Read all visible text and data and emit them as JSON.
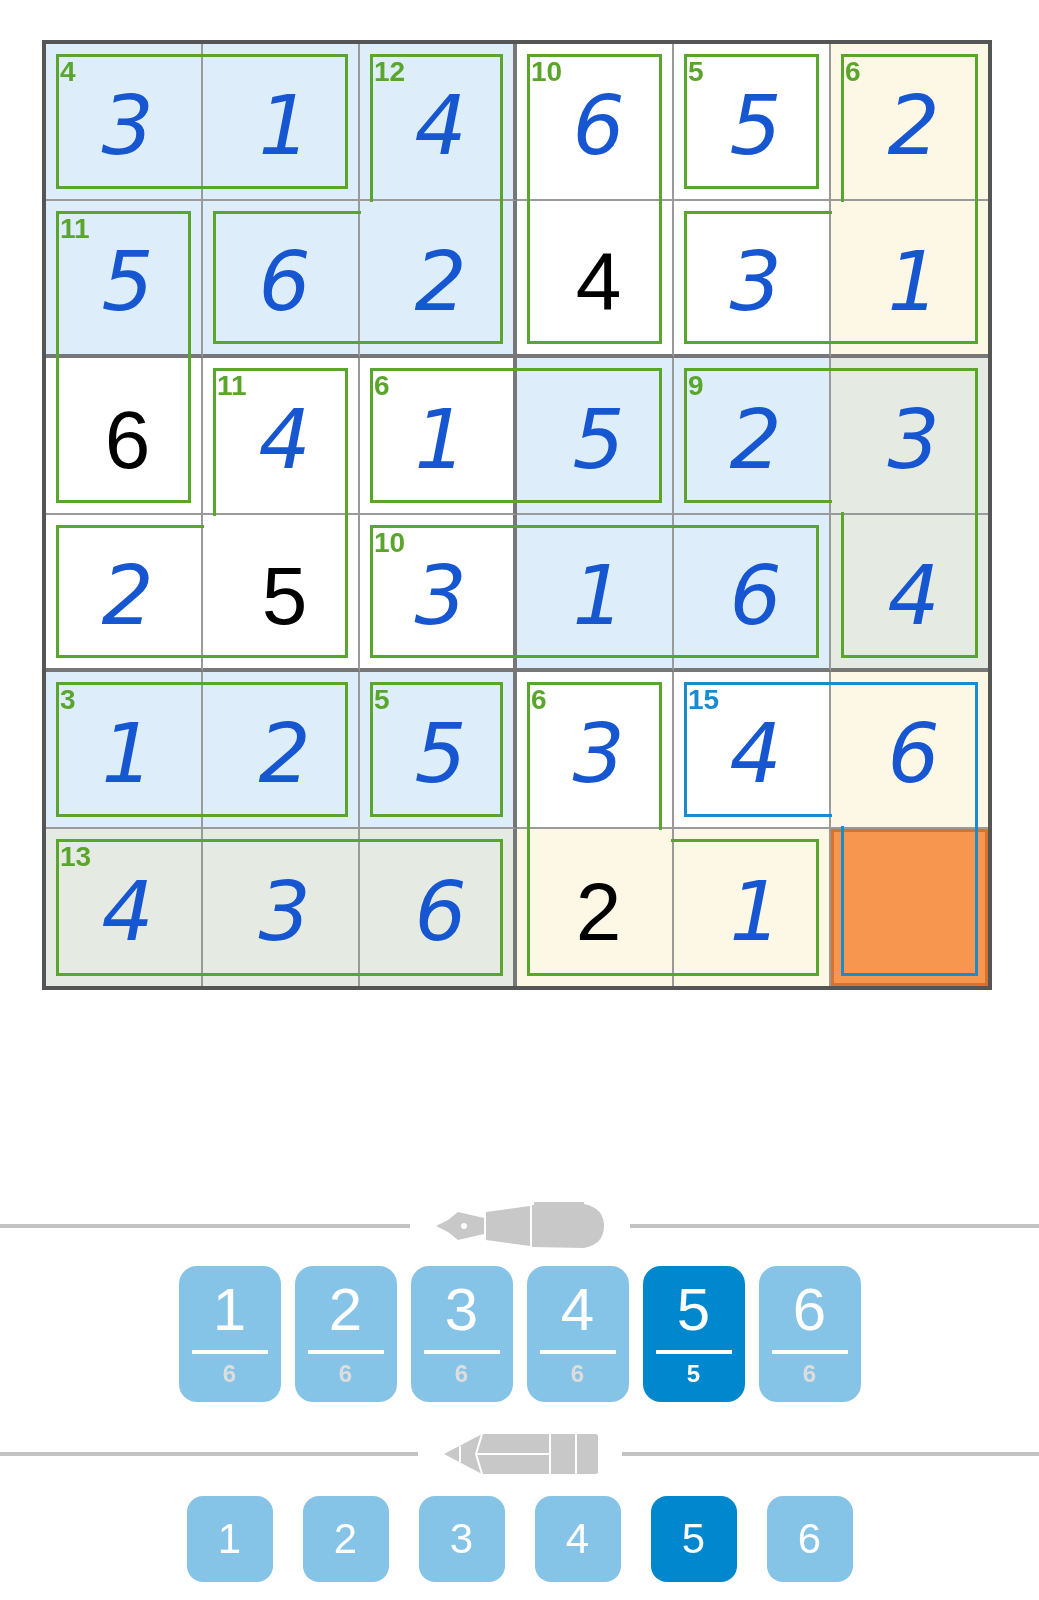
{
  "board": {
    "rows": [
      {
        "cells": [
          {
            "value": "3",
            "kind": "entered",
            "color": "#ddeefa",
            "selected": false,
            "cage_sum": "4",
            "cage_selected": false,
            "cage_edges": {
              "top": true,
              "right": false,
              "bottom": true,
              "left": true
            }
          },
          {
            "value": "1",
            "kind": "entered",
            "color": "#ddeefa",
            "selected": false,
            "cage_selected": false,
            "cage_edges": {
              "top": true,
              "right": true,
              "bottom": true,
              "left": false
            }
          },
          {
            "value": "4",
            "kind": "entered",
            "color": "#ddeefa",
            "selected": false,
            "cage_sum": "12",
            "cage_selected": false,
            "cage_edges": {
              "top": true,
              "right": true,
              "bottom": false,
              "left": true
            }
          },
          {
            "value": "6",
            "kind": "entered",
            "color": "#ffffff",
            "selected": false,
            "cage_sum": "10",
            "cage_selected": false,
            "cage_edges": {
              "top": true,
              "right": true,
              "bottom": false,
              "left": true
            }
          },
          {
            "value": "5",
            "kind": "entered",
            "color": "#ffffff",
            "selected": false,
            "cage_sum": "5",
            "cage_selected": false,
            "cage_edges": {
              "top": true,
              "right": true,
              "bottom": true,
              "left": true
            }
          },
          {
            "value": "2",
            "kind": "entered",
            "color": "#fdf8e6",
            "selected": false,
            "cage_sum": "6",
            "cage_selected": false,
            "cage_edges": {
              "top": true,
              "right": true,
              "bottom": false,
              "left": true
            }
          }
        ]
      },
      {
        "cells": [
          {
            "value": "5",
            "kind": "entered",
            "color": "#ddeefa",
            "selected": false,
            "cage_sum": "11",
            "cage_selected": false,
            "cage_edges": {
              "top": true,
              "right": true,
              "bottom": false,
              "left": true
            }
          },
          {
            "value": "6",
            "kind": "entered",
            "color": "#ddeefa",
            "selected": false,
            "cage_selected": false,
            "cage_edges": {
              "top": true,
              "right": false,
              "bottom": true,
              "left": true
            }
          },
          {
            "value": "2",
            "kind": "entered",
            "color": "#ddeefa",
            "selected": false,
            "cage_selected": false,
            "cage_edges": {
              "top": false,
              "right": true,
              "bottom": true,
              "left": false
            }
          },
          {
            "value": "4",
            "kind": "given",
            "color": "#ffffff",
            "selected": false,
            "cage_selected": false,
            "cage_edges": {
              "top": false,
              "right": true,
              "bottom": true,
              "left": true
            }
          },
          {
            "value": "3",
            "kind": "entered",
            "color": "#ffffff",
            "selected": false,
            "cage_selected": false,
            "cage_edges": {
              "top": true,
              "right": false,
              "bottom": true,
              "left": true
            }
          },
          {
            "value": "1",
            "kind": "entered",
            "color": "#fdf8e6",
            "selected": false,
            "cage_selected": false,
            "cage_edges": {
              "top": false,
              "right": true,
              "bottom": true,
              "left": false
            }
          }
        ]
      },
      {
        "cells": [
          {
            "value": "6",
            "kind": "given",
            "color": "#ffffff",
            "selected": false,
            "cage_selected": false,
            "cage_edges": {
              "top": false,
              "right": true,
              "bottom": true,
              "left": true
            }
          },
          {
            "value": "4",
            "kind": "entered",
            "color": "#ffffff",
            "selected": false,
            "cage_sum": "11",
            "cage_selected": false,
            "cage_edges": {
              "top": true,
              "right": true,
              "bottom": false,
              "left": true
            }
          },
          {
            "value": "1",
            "kind": "entered",
            "color": "#ffffff",
            "selected": false,
            "cage_sum": "6",
            "cage_selected": false,
            "cage_edges": {
              "top": true,
              "right": false,
              "bottom": true,
              "left": true
            }
          },
          {
            "value": "5",
            "kind": "entered",
            "color": "#ddeefa",
            "selected": false,
            "cage_selected": false,
            "cage_edges": {
              "top": true,
              "right": true,
              "bottom": true,
              "left": false
            }
          },
          {
            "value": "2",
            "kind": "entered",
            "color": "#ddeefa",
            "selected": false,
            "cage_sum": "9",
            "cage_selected": false,
            "cage_edges": {
              "top": true,
              "right": false,
              "bottom": true,
              "left": true
            }
          },
          {
            "value": "3",
            "kind": "entered",
            "color": "#e5ebe3",
            "selected": false,
            "cage_selected": false,
            "cage_edges": {
              "top": true,
              "right": true,
              "bottom": false,
              "left": false
            }
          }
        ]
      },
      {
        "cells": [
          {
            "value": "2",
            "kind": "entered",
            "color": "#ffffff",
            "selected": false,
            "cage_selected": false,
            "cage_edges": {
              "top": true,
              "right": false,
              "bottom": true,
              "left": true
            }
          },
          {
            "value": "5",
            "kind": "given",
            "color": "#ffffff",
            "selected": false,
            "cage_selected": false,
            "cage_edges": {
              "top": false,
              "right": true,
              "bottom": true,
              "left": false
            }
          },
          {
            "value": "3",
            "kind": "entered",
            "color": "#ffffff",
            "selected": false,
            "cage_sum": "10",
            "cage_selected": false,
            "cage_edges": {
              "top": true,
              "right": false,
              "bottom": true,
              "left": true
            }
          },
          {
            "value": "1",
            "kind": "entered",
            "color": "#ddeefa",
            "selected": false,
            "cage_selected": false,
            "cage_edges": {
              "top": true,
              "right": false,
              "bottom": true,
              "left": false
            }
          },
          {
            "value": "6",
            "kind": "entered",
            "color": "#ddeefa",
            "selected": false,
            "cage_selected": false,
            "cage_edges": {
              "top": true,
              "right": true,
              "bottom": true,
              "left": false
            }
          },
          {
            "value": "4",
            "kind": "entered",
            "color": "#e5ebe3",
            "selected": false,
            "cage_selected": false,
            "cage_edges": {
              "top": false,
              "right": true,
              "bottom": true,
              "left": true
            }
          }
        ]
      },
      {
        "cells": [
          {
            "value": "1",
            "kind": "entered",
            "color": "#ddeefa",
            "selected": false,
            "cage_sum": "3",
            "cage_selected": false,
            "cage_edges": {
              "top": true,
              "right": false,
              "bottom": true,
              "left": true
            }
          },
          {
            "value": "2",
            "kind": "entered",
            "color": "#ddeefa",
            "selected": false,
            "cage_selected": false,
            "cage_edges": {
              "top": true,
              "right": true,
              "bottom": true,
              "left": false
            }
          },
          {
            "value": "5",
            "kind": "entered",
            "color": "#ddeefa",
            "selected": false,
            "cage_sum": "5",
            "cage_selected": false,
            "cage_edges": {
              "top": true,
              "right": true,
              "bottom": true,
              "left": true
            }
          },
          {
            "value": "3",
            "kind": "entered",
            "color": "#ffffff",
            "selected": false,
            "cage_sum": "6",
            "cage_selected": false,
            "cage_edges": {
              "top": true,
              "right": true,
              "bottom": false,
              "left": true
            }
          },
          {
            "value": "4",
            "kind": "entered",
            "color": "#ffffff",
            "selected": false,
            "cage_sum": "15",
            "cage_selected": true,
            "cage_edges": {
              "top": true,
              "right": false,
              "bottom": true,
              "left": true
            }
          },
          {
            "value": "6",
            "kind": "entered",
            "color": "#fdf8e6",
            "selected": false,
            "cage_selected": true,
            "cage_edges": {
              "top": true,
              "right": true,
              "bottom": false,
              "left": false
            }
          }
        ]
      },
      {
        "cells": [
          {
            "value": "4",
            "kind": "entered",
            "color": "#e5ebe3",
            "selected": false,
            "cage_sum": "13",
            "cage_selected": false,
            "cage_edges": {
              "top": true,
              "right": false,
              "bottom": true,
              "left": true
            }
          },
          {
            "value": "3",
            "kind": "entered",
            "color": "#e5ebe3",
            "selected": false,
            "cage_selected": false,
            "cage_edges": {
              "top": true,
              "right": false,
              "bottom": true,
              "left": false
            }
          },
          {
            "value": "6",
            "kind": "entered",
            "color": "#e5ebe3",
            "selected": false,
            "cage_selected": false,
            "cage_edges": {
              "top": true,
              "right": true,
              "bottom": true,
              "left": false
            }
          },
          {
            "value": "2",
            "kind": "given",
            "color": "#fdf8e6",
            "selected": false,
            "cage_selected": false,
            "cage_edges": {
              "top": false,
              "right": false,
              "bottom": true,
              "left": true
            }
          },
          {
            "value": "1",
            "kind": "entered",
            "color": "#fdf8e6",
            "selected": false,
            "cage_selected": false,
            "cage_edges": {
              "top": true,
              "right": true,
              "bottom": true,
              "left": false
            }
          },
          {
            "kind": "empty",
            "selected": true,
            "cage_selected": true,
            "cage_edges": {
              "top": false,
              "right": true,
              "bottom": true,
              "left": true
            }
          }
        ]
      }
    ]
  },
  "pen_pad": [
    {
      "digit": "1",
      "count": "6",
      "selected": false
    },
    {
      "digit": "2",
      "count": "6",
      "selected": false
    },
    {
      "digit": "3",
      "count": "6",
      "selected": false
    },
    {
      "digit": "4",
      "count": "6",
      "selected": false
    },
    {
      "digit": "5",
      "count": "5",
      "selected": true
    },
    {
      "digit": "6",
      "count": "6",
      "selected": false
    }
  ],
  "pencil_pad": [
    {
      "digit": "1",
      "selected": false
    },
    {
      "digit": "2",
      "selected": false
    },
    {
      "digit": "3",
      "selected": false
    },
    {
      "digit": "4",
      "selected": false
    },
    {
      "digit": "5",
      "selected": true
    },
    {
      "digit": "6",
      "selected": false
    }
  ]
}
